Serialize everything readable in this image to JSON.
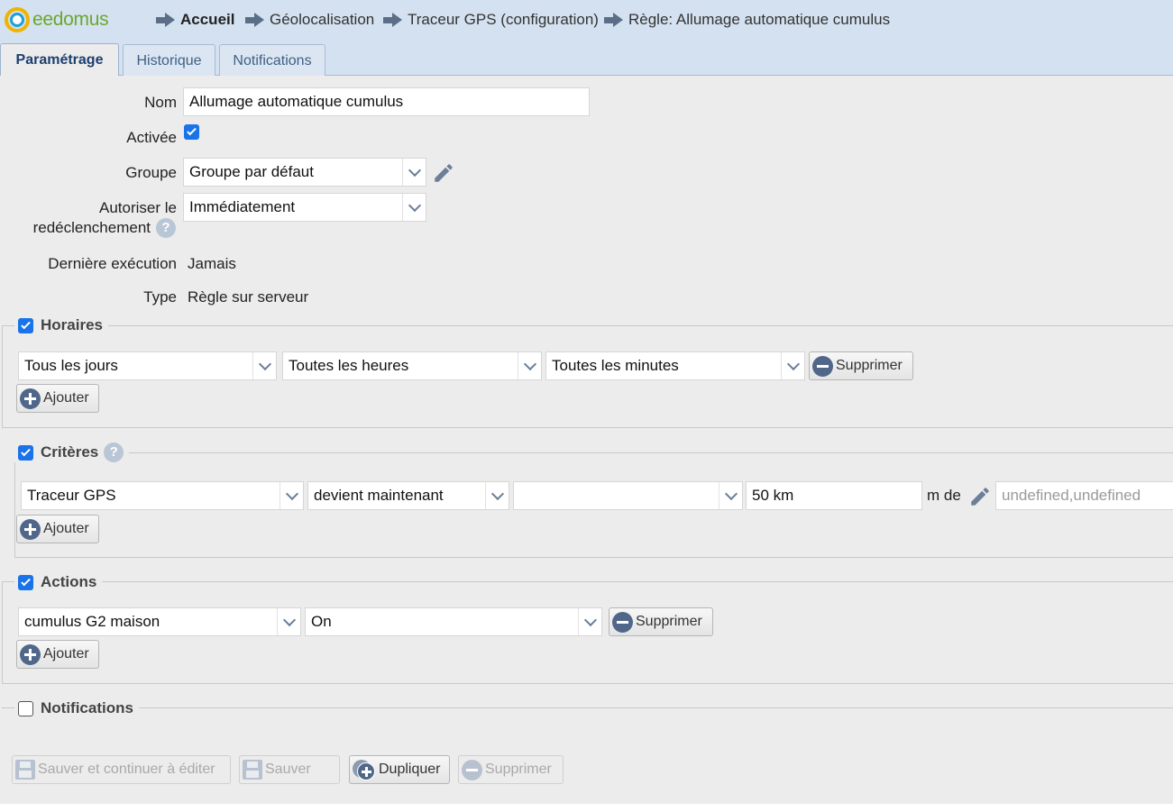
{
  "app": {
    "brand": "eedomus"
  },
  "breadcrumb": [
    {
      "label": "Accueil"
    },
    {
      "label": "Géolocalisation"
    },
    {
      "label": "Traceur GPS (configuration)"
    },
    {
      "label": "Règle: Allumage automatique cumulus"
    }
  ],
  "tabs": [
    {
      "label": "Paramétrage",
      "active": true
    },
    {
      "label": "Historique",
      "active": false
    },
    {
      "label": "Notifications",
      "active": false
    }
  ],
  "form": {
    "nom_label": "Nom",
    "nom_value": "Allumage automatique cumulus",
    "activee_label": "Activée",
    "activee_checked": true,
    "groupe_label": "Groupe",
    "groupe_value": "Groupe par défaut",
    "redecl_label_1": "Autoriser le",
    "redecl_label_2": "redéclenchement",
    "redecl_value": "Immédiatement",
    "derniere_label": "Dernière exécution",
    "derniere_value": "Jamais",
    "type_label": "Type",
    "type_value": "Règle sur serveur"
  },
  "horaires": {
    "title": "Horaires",
    "checked": true,
    "jours": "Tous les jours",
    "heures": "Toutes les heures",
    "minutes": "Toutes les minutes",
    "delete_label": "Supprimer",
    "add_label": "Ajouter"
  },
  "criteres": {
    "title": "Critères",
    "checked": true,
    "device": "Traceur GPS",
    "condition": "devient maintenant",
    "value": "",
    "distance": "50 km",
    "m_de": "m de",
    "coords_placeholder": "undefined,undefined",
    "add_label": "Ajouter"
  },
  "actions": {
    "title": "Actions",
    "checked": true,
    "device": "cumulus G2 maison",
    "value": "On",
    "delete_label": "Supprimer",
    "add_label": "Ajouter"
  },
  "notifications": {
    "title": "Notifications",
    "checked": false
  },
  "footer": {
    "save_continue": "Sauver et continuer à éditer",
    "save": "Sauver",
    "duplicate": "Dupliquer",
    "delete": "Supprimer"
  },
  "colors": {
    "header_bg": "#d4e1f0",
    "content_bg": "#ececec",
    "accent": "#1a73e8",
    "icon": "#51678a",
    "brand_green": "#6aa82c"
  }
}
